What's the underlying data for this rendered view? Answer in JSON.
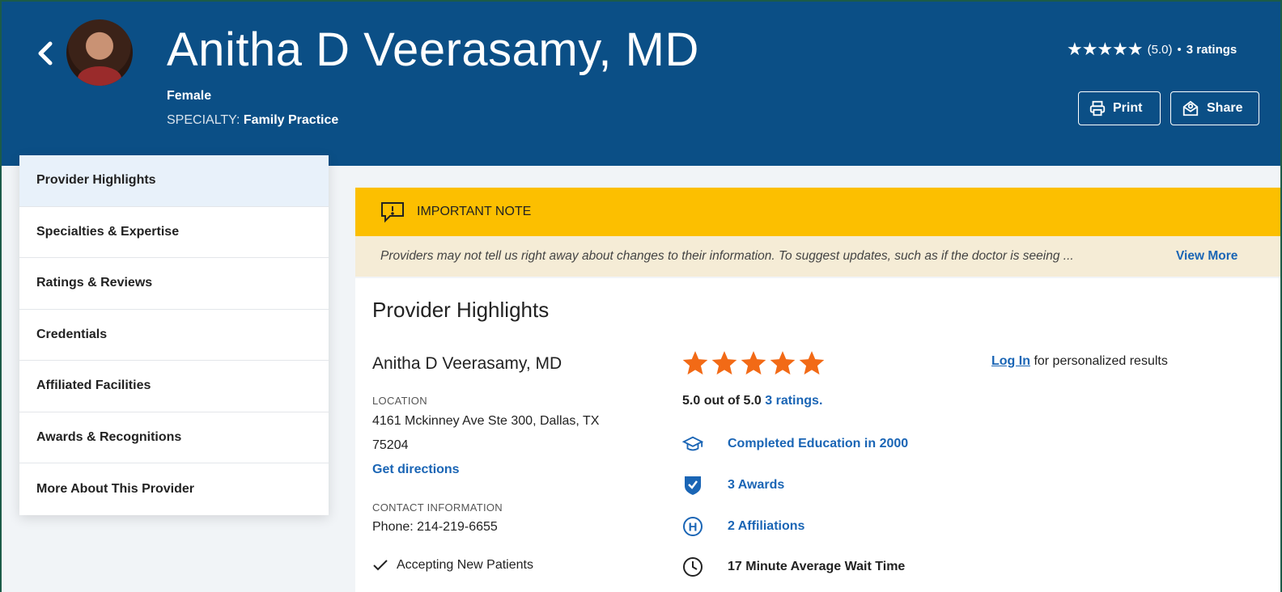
{
  "header": {
    "name": "Anitha D Veerasamy, MD",
    "gender": "Female",
    "specialty_label": "SPECIALTY:",
    "specialty_value": "Family Practice",
    "rating_score": "(5.0)",
    "rating_sep": "•",
    "rating_count": "3 ratings",
    "print_label": "Print",
    "share_label": "Share"
  },
  "sidebar": {
    "items": [
      {
        "label": "Provider Highlights"
      },
      {
        "label": "Specialties & Expertise"
      },
      {
        "label": "Ratings & Reviews"
      },
      {
        "label": "Credentials"
      },
      {
        "label": "Affiliated Facilities"
      },
      {
        "label": "Awards & Recognitions"
      },
      {
        "label": "More About This Provider"
      }
    ]
  },
  "note": {
    "title": "IMPORTANT NOTE",
    "body": "Providers may not tell us right away about changes to their information. To suggest updates, such as if the doctor is seeing ...",
    "view_more": "View More"
  },
  "highlights": {
    "title": "Provider Highlights",
    "doctor_name": "Anitha D Veerasamy, MD",
    "location_label": "LOCATION",
    "address_line1": "4161 Mckinney Ave Ste 300, Dallas, TX",
    "address_line2": "75204",
    "directions": "Get directions",
    "contact_label": "CONTACT INFORMATION",
    "phone": "Phone: 214-219-6655",
    "accepting": "Accepting New Patients",
    "stars": 5,
    "score_text": "5.0 out of 5.0",
    "ratings_link": "3 ratings.",
    "education": "Completed Education in 2000",
    "awards": "3 Awards",
    "affiliations": "2 Affiliations",
    "wait_time": "17 Minute Average Wait Time",
    "login_link": "Log In",
    "login_text": "for personalized results"
  },
  "colors": {
    "header_bg": "#0b4f86",
    "note_bg": "#fcbf00",
    "link": "#1a65b5",
    "star_orange": "#f26a16"
  }
}
